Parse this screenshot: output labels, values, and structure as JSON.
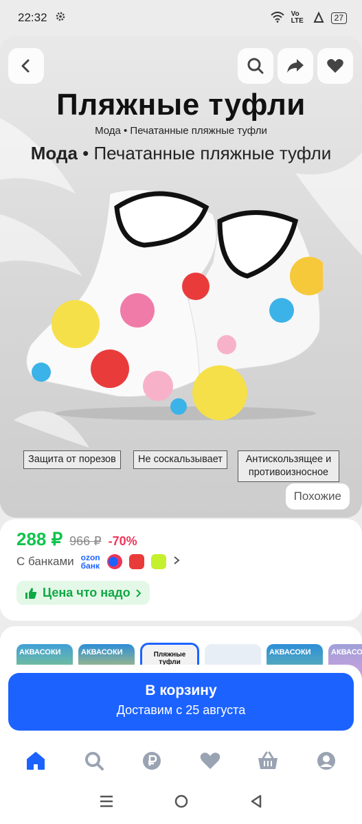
{
  "status": {
    "time": "22:32",
    "network": "Vo LTE",
    "battery": "27"
  },
  "hero": {
    "title": "Пляжные туфли",
    "subtitle_small": "Мода • Печатанные пляжные туфли",
    "subtitle_large_bold": "Мода",
    "subtitle_large_rest": "• Печатанные пляжные туфли",
    "features": [
      "Защита от порезов",
      "Не соскальзывает",
      "Антискользящее и противоизносное"
    ],
    "similar_label": "Похожие"
  },
  "price": {
    "current": "288 ₽",
    "old": "966 ₽",
    "discount": "-70%",
    "banks_label": "С банками",
    "ozon_bank_top": "ozon",
    "ozon_bank_bottom": "банк",
    "tag_label": "Цена что надо"
  },
  "thumbnails": [
    "АКВАСОКИ",
    "АКВАСОКИ",
    "Пляжные туфли",
    "",
    "АКВАСОКИ",
    "АКВАСОКИ"
  ],
  "cart": {
    "title": "В корзину",
    "subtitle": "Доставим с 25 августа"
  },
  "colors": {
    "accent": "#1c62ff",
    "price_green": "#10c44c",
    "discount_red": "#f0355a"
  },
  "nav": [
    "home-icon",
    "search-icon",
    "ruble-icon",
    "heart-icon",
    "basket-icon",
    "profile-icon"
  ]
}
